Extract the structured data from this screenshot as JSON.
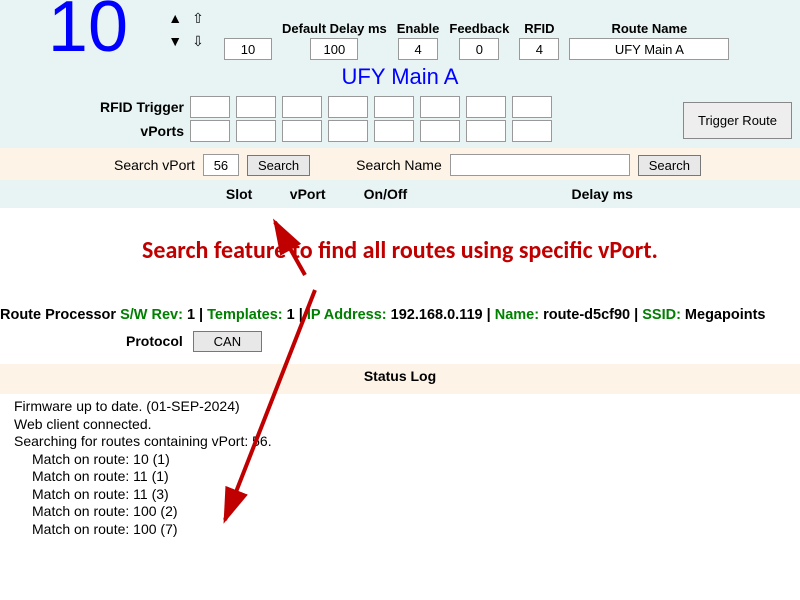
{
  "top": {
    "big_number": "10",
    "fields": {
      "delay_small_label": "",
      "delay_small": "10",
      "default_delay_label": "Default Delay ms",
      "default_delay": "100",
      "enable_label": "Enable",
      "enable": "4",
      "feedback_label": "Feedback",
      "feedback": "0",
      "rfid_label": "RFID",
      "rfid": "4",
      "route_name_label": "Route Name",
      "route_name": "UFY Main A"
    },
    "route_title": "UFY Main A",
    "rfid_trigger_label": "RFID Trigger",
    "vports_label": "vPorts",
    "trigger_button": "Trigger Route"
  },
  "search": {
    "vport_label": "Search vPort",
    "vport_value": "56",
    "vport_button": "Search",
    "name_label": "Search Name",
    "name_value": "",
    "name_button": "Search"
  },
  "columns": {
    "slot": "Slot",
    "vport": "vPort",
    "onoff": "On/Off",
    "delay": "Delay ms"
  },
  "annotation": "Search feature to find all routes using specific vPort.",
  "proc": {
    "prefix": "Route Processor ",
    "sw_label": "S/W Rev:",
    "sw": " 1 ",
    "tpl_label": "Templates:",
    "tpl": " 1 ",
    "ip_label": "IP Address:",
    "ip": " 192.168.0.119 ",
    "name_label": "Name:",
    "name": " route-d5cf90 ",
    "ssid_label": "SSID:",
    "ssid": " Megapoints"
  },
  "protocol": {
    "label": "Protocol",
    "value": "CAN"
  },
  "status_header": "Status Log",
  "log": {
    "l1": "Firmware up to date. (01-SEP-2024)",
    "l2": "Web client connected.",
    "l3": "Searching for routes containing vPort: 56.",
    "matches": [
      "Match on route: 10 (1)",
      "Match on route: 11 (1)",
      "Match on route: 11 (3)",
      "Match on route: 100 (2)",
      "Match on route: 100 (7)"
    ]
  }
}
